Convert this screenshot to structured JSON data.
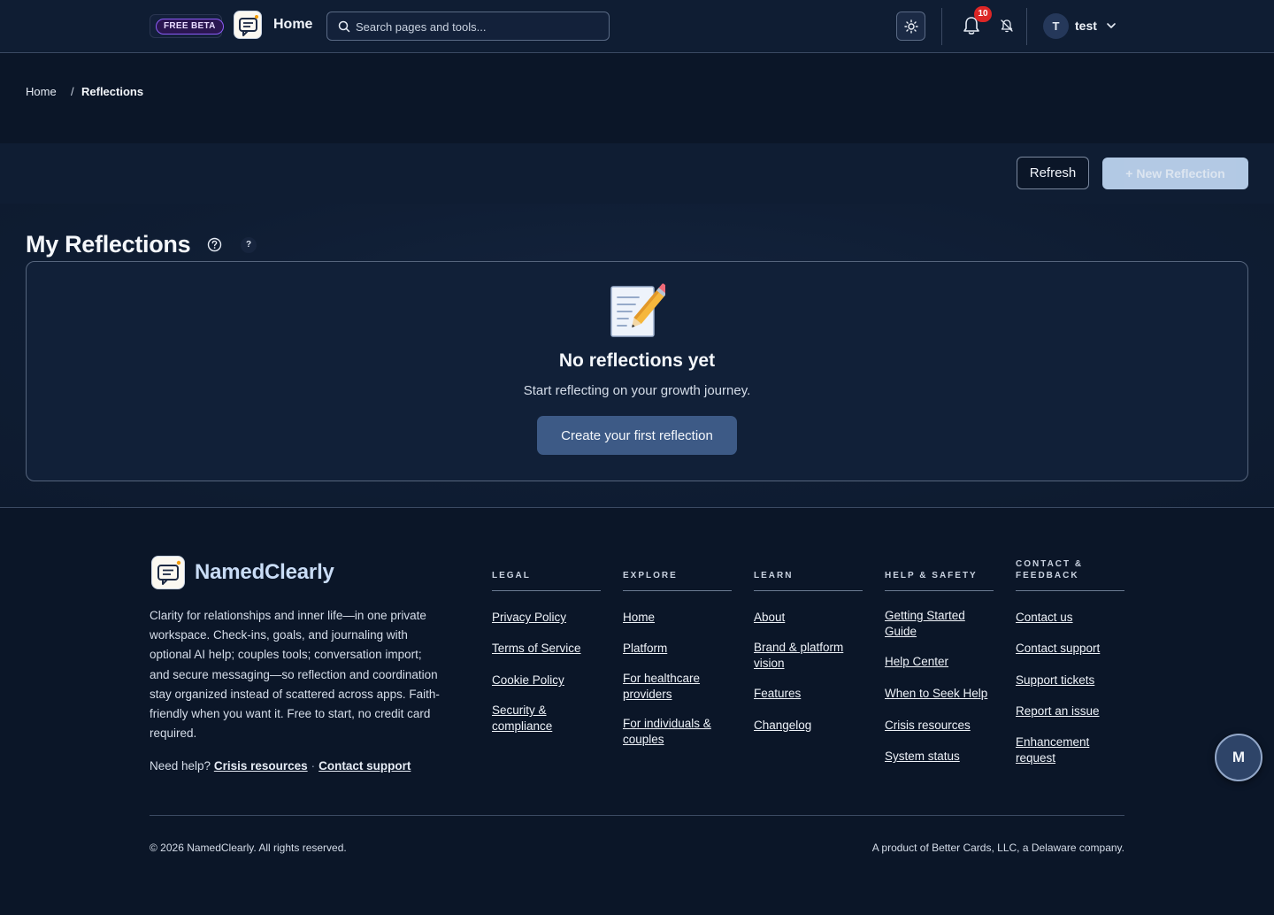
{
  "header": {
    "beta_label": "FREE BETA",
    "home_label": "Home",
    "search_placeholder": "Search pages and tools...",
    "notification_count": "10",
    "user_initial": "T",
    "user_name": "test"
  },
  "breadcrumb": {
    "home": "Home",
    "separator": "/",
    "current": "Reflections"
  },
  "actions": {
    "refresh_label": "Refresh",
    "new_label": "+ New Reflection"
  },
  "main": {
    "title": "My Reflections",
    "help_q": "?",
    "empty_icon": "memo-pencil-icon",
    "empty_title": "No reflections yet",
    "empty_subtitle": "Start reflecting on your growth journey.",
    "create_label": "Create your first reflection"
  },
  "footer": {
    "brand": "NamedClearly",
    "description": "Clarity for relationships and inner life—in one private workspace. Check-ins, goals, and journaling with optional AI help; couples tools; conversation import; and secure messaging—so reflection and coordination stay organized instead of scattered across apps. Faith-friendly when you want it. Free to start, no credit card required.",
    "need_help": "Need help?",
    "crisis_link": "Crisis resources",
    "dot": "·",
    "contact_link": "Contact support",
    "columns": [
      {
        "heading": "LEGAL",
        "links": [
          "Privacy Policy",
          "Terms of Service",
          "Cookie Policy",
          "Security & compliance"
        ]
      },
      {
        "heading": "EXPLORE",
        "links": [
          "Home",
          "Platform",
          "For healthcare providers",
          "For individuals & couples"
        ]
      },
      {
        "heading": "LEARN",
        "links": [
          "About",
          "Brand & platform vision",
          "Features",
          "Changelog"
        ]
      },
      {
        "heading": "HELP & SAFETY",
        "links": [
          "Getting Started Guide",
          "Help Center",
          "When to Seek Help",
          "Crisis resources",
          "System status"
        ]
      },
      {
        "heading": "CONTACT & FEEDBACK",
        "links": [
          "Contact us",
          "Contact support",
          "Support tickets",
          "Report an issue",
          "Enhancement request"
        ]
      }
    ],
    "copyright": "© 2026 NamedClearly. All rights reserved.",
    "product": "A product of Better Cards, LLC, a Delaware company."
  },
  "fab_label": "M",
  "colors": {
    "background": "#0b1628",
    "accent": "#3d5a86",
    "badge": "#dc2626",
    "beta": "#8b5cf6"
  }
}
